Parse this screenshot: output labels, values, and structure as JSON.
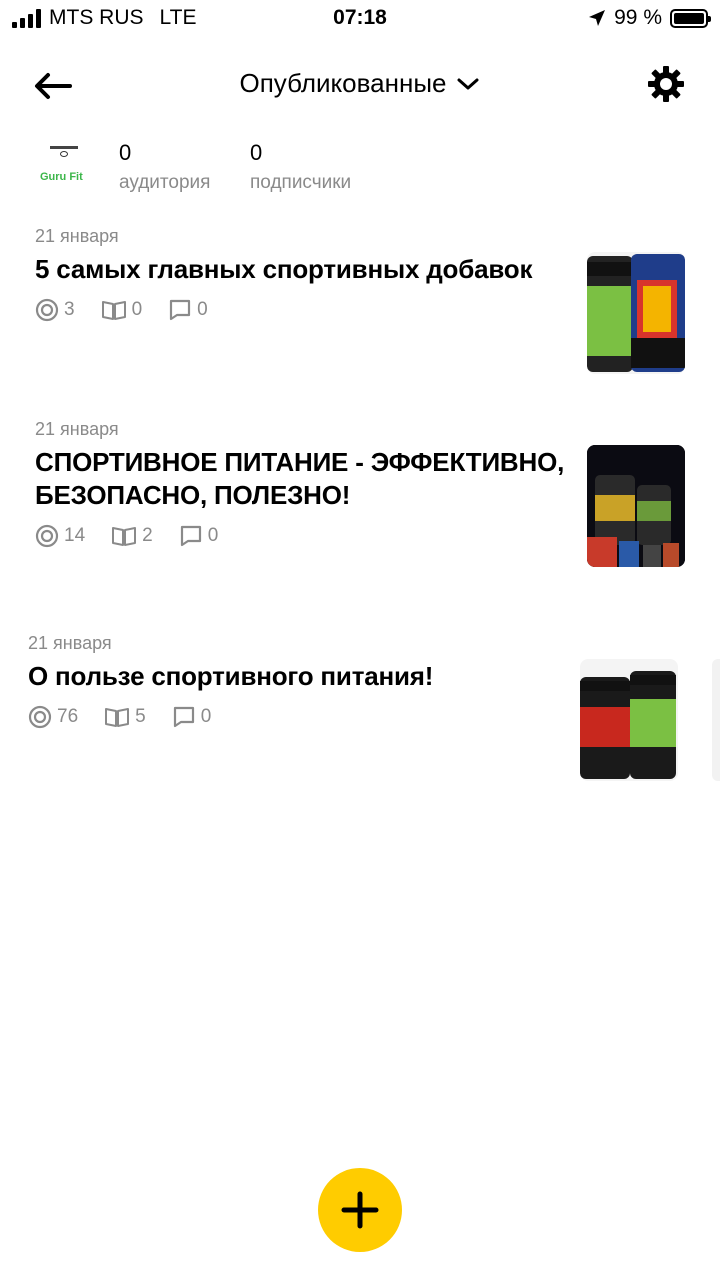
{
  "status_bar": {
    "carrier": "MTS RUS",
    "network": "LTE",
    "time": "07:18",
    "battery": "99 %"
  },
  "header": {
    "title": "Опубликованные"
  },
  "profile": {
    "avatar_brand": "Guru Fit",
    "audience_value": "0",
    "audience_label": "аудитория",
    "subscribers_value": "0",
    "subscribers_label": "подписчики"
  },
  "articles": [
    {
      "date": "21 января",
      "title": "5 самых главных спортивных добавок",
      "views": "3",
      "reads": "0",
      "comments": "0"
    },
    {
      "date": "21 января",
      "title": "СПОРТИВНОЕ ПИТАНИЕ - ЭФФЕКТИВНО, БЕЗОПАСНО, ПОЛЕЗНО!",
      "views": "14",
      "reads": "2",
      "comments": "0"
    },
    {
      "date": "21 января",
      "title": "О пользе спортивного питания!",
      "views": "76",
      "reads": "5",
      "comments": "0"
    }
  ],
  "colors": {
    "fab": "#ffcc00",
    "secondary_text": "#8a8a8a"
  }
}
